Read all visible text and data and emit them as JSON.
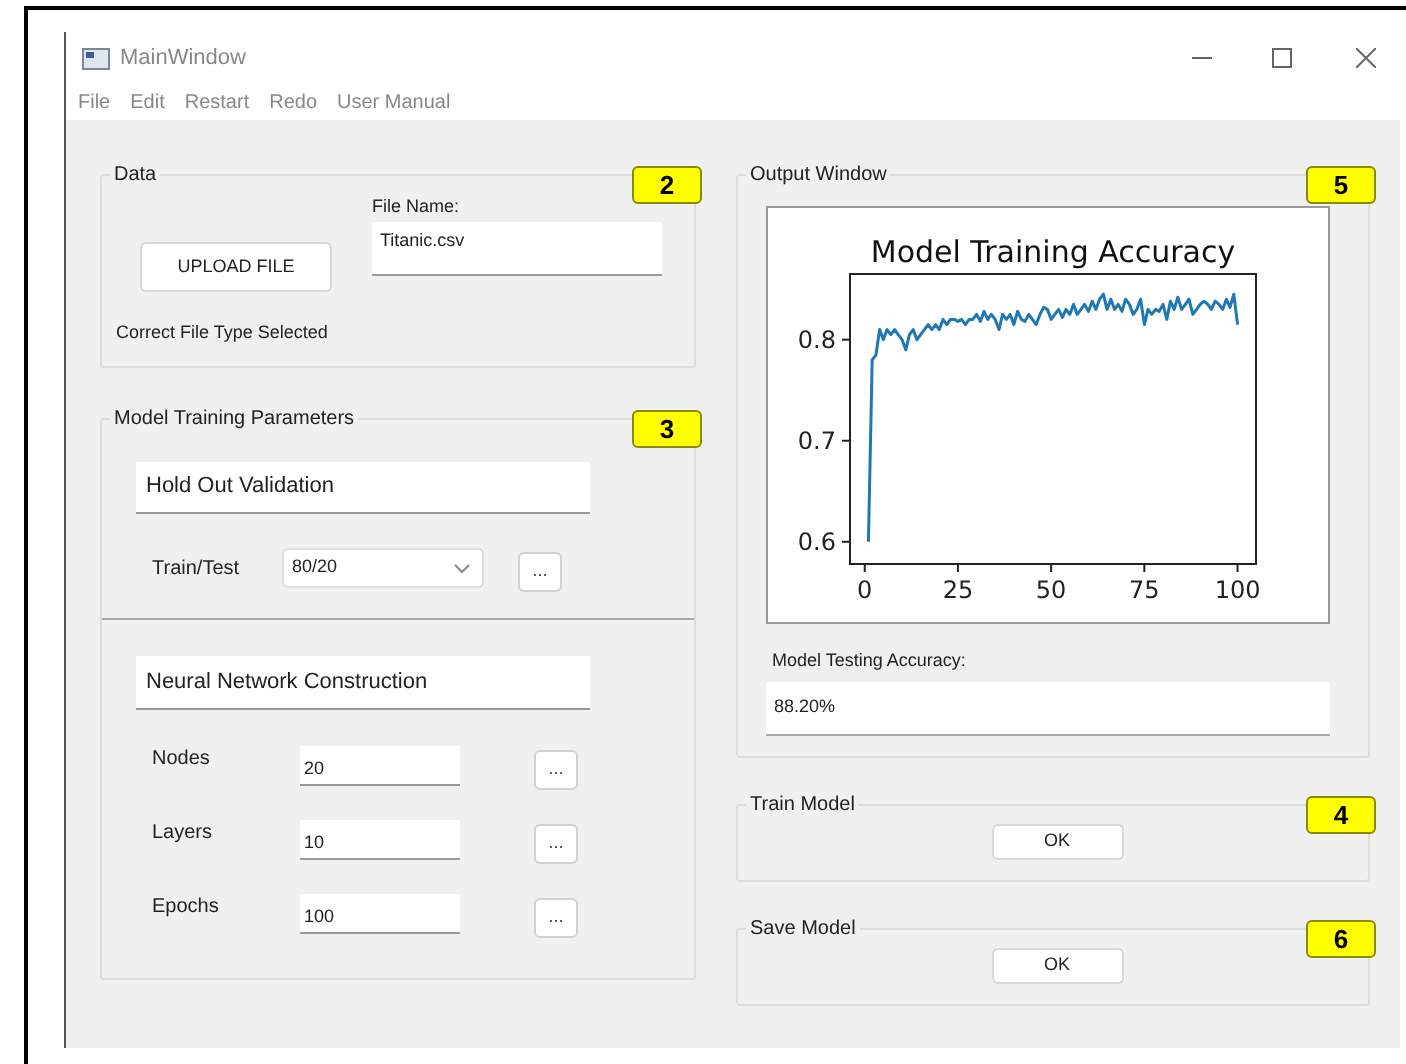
{
  "window": {
    "title": "MainWindow"
  },
  "menu": [
    "File",
    "Edit",
    "Restart",
    "Redo",
    "User Manual"
  ],
  "data_group": {
    "title": "Data",
    "badge": "2",
    "upload_button": "UPLOAD FILE",
    "file_name_label": "File Name:",
    "file_name": "Titanic.csv",
    "status": "Correct File Type Selected"
  },
  "training_group": {
    "title": "Model Training Parameters",
    "badge": "3",
    "hold_out": {
      "heading": "Hold Out Validation",
      "label": "Train/Test",
      "value": "80/20",
      "more": "..."
    },
    "network": {
      "heading": "Neural Network Construction",
      "rows": [
        {
          "label": "Nodes",
          "value": "20",
          "more": "..."
        },
        {
          "label": "Layers",
          "value": "10",
          "more": "..."
        },
        {
          "label": "Epochs",
          "value": "100",
          "more": "..."
        }
      ]
    }
  },
  "output_group": {
    "title": "Output Window",
    "badge": "5",
    "chart_data": {
      "type": "line",
      "title": "Model Training Accuracy",
      "xlim": [
        -3.95,
        104.95
      ],
      "ylim": [
        0.578,
        0.865
      ],
      "xticks": [
        0,
        25,
        50,
        75,
        100
      ],
      "yticks": [
        {
          "value": 0.6,
          "label": "0.6"
        },
        {
          "value": 0.7,
          "label": "0.7"
        },
        {
          "value": 0.8,
          "label": "0.8"
        }
      ],
      "x": [
        1,
        2,
        3,
        4,
        5,
        6,
        7,
        8,
        9,
        10,
        11,
        12,
        13,
        14,
        15,
        16,
        17,
        18,
        19,
        20,
        21,
        22,
        23,
        24,
        25,
        26,
        27,
        28,
        29,
        30,
        31,
        32,
        33,
        34,
        35,
        36,
        37,
        38,
        39,
        40,
        41,
        42,
        43,
        44,
        45,
        46,
        47,
        48,
        49,
        50,
        51,
        52,
        53,
        54,
        55,
        56,
        57,
        58,
        59,
        60,
        61,
        62,
        63,
        64,
        65,
        66,
        67,
        68,
        69,
        70,
        71,
        72,
        73,
        74,
        75,
        76,
        77,
        78,
        79,
        80,
        81,
        82,
        83,
        84,
        85,
        86,
        87,
        88,
        89,
        90,
        91,
        92,
        93,
        94,
        95,
        96,
        97,
        98,
        99,
        100
      ],
      "series": [
        {
          "color": "#1f77b4",
          "values": [
            0.6,
            0.78,
            0.785,
            0.81,
            0.8,
            0.81,
            0.805,
            0.81,
            0.805,
            0.8,
            0.79,
            0.805,
            0.81,
            0.8,
            0.805,
            0.81,
            0.815,
            0.81,
            0.815,
            0.81,
            0.82,
            0.815,
            0.82,
            0.82,
            0.818,
            0.82,
            0.815,
            0.82,
            0.82,
            0.825,
            0.818,
            0.828,
            0.82,
            0.825,
            0.82,
            0.81,
            0.825,
            0.82,
            0.825,
            0.815,
            0.828,
            0.82,
            0.818,
            0.825,
            0.82,
            0.815,
            0.825,
            0.832,
            0.83,
            0.82,
            0.825,
            0.83,
            0.822,
            0.83,
            0.825,
            0.835,
            0.825,
            0.83,
            0.835,
            0.828,
            0.838,
            0.83,
            0.84,
            0.845,
            0.83,
            0.84,
            0.83,
            0.835,
            0.828,
            0.84,
            0.835,
            0.825,
            0.83,
            0.84,
            0.815,
            0.83,
            0.825,
            0.83,
            0.828,
            0.835,
            0.82,
            0.838,
            0.83,
            0.842,
            0.83,
            0.835,
            0.84,
            0.825,
            0.83,
            0.835,
            0.838,
            0.835,
            0.83,
            0.838,
            0.835,
            0.83,
            0.84,
            0.832,
            0.845,
            0.815
          ]
        }
      ]
    },
    "accuracy_label": "Model Testing Accuracy:",
    "accuracy": "88.20%"
  },
  "train_group": {
    "title": "Train Model",
    "badge": "4",
    "button": "OK"
  },
  "save_group": {
    "title": "Save Model",
    "badge": "6",
    "button": "OK"
  }
}
